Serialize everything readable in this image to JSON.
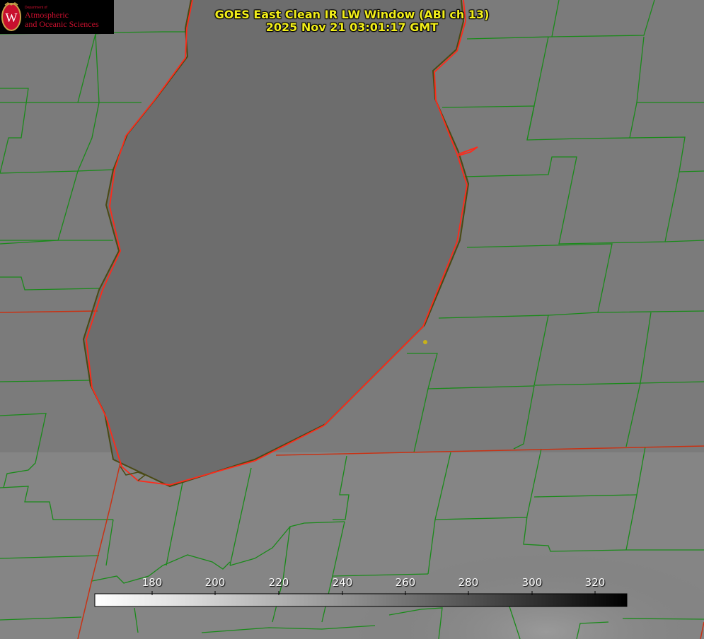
{
  "title": {
    "line1": "GOES East Clean IR LW Window (ABI ch 13)",
    "line2": "2025 Nov 21 03:01:17 GMT"
  },
  "logo": {
    "seal_letter": "W",
    "dept": "Department of",
    "line1": "Atmospheric",
    "line2": "and Oceanic Sciences"
  },
  "colorbar": {
    "ticks": [
      "180",
      "200",
      "220",
      "240",
      "260",
      "280",
      "300",
      "320"
    ],
    "gradient": "white-to-black"
  },
  "colors": {
    "county_lines": "#1a8a1a",
    "state_lines": "#c83214",
    "shoreline": "#ff2a1a",
    "title_text": "#f2ee1a",
    "logo_text": "#c8102e",
    "marker": "#c8b21a"
  }
}
